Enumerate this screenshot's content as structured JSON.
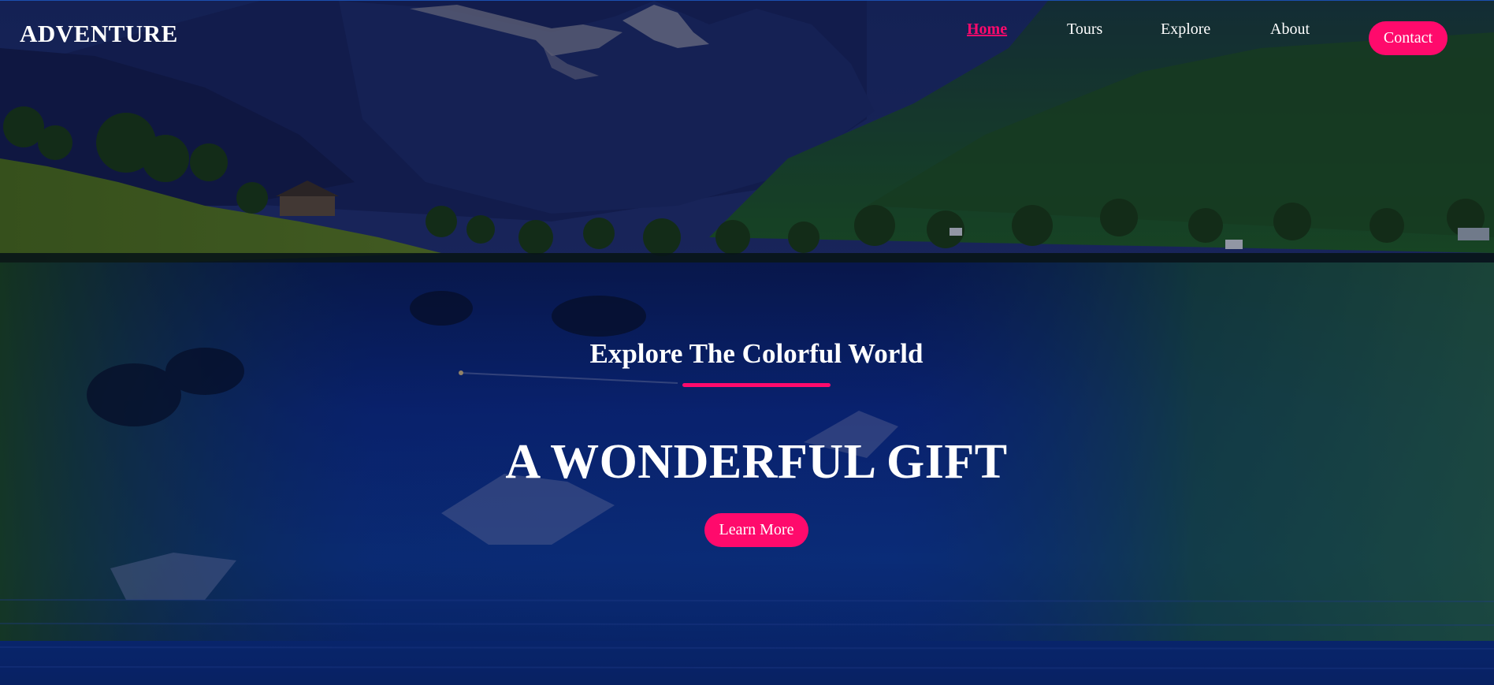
{
  "brand": {
    "name": "ADVENTURE"
  },
  "nav": {
    "items": [
      {
        "label": "Home",
        "active": true
      },
      {
        "label": "Tours",
        "active": false
      },
      {
        "label": "Explore",
        "active": false
      },
      {
        "label": "About",
        "active": false
      }
    ],
    "contact_label": "Contact"
  },
  "hero": {
    "subtitle": "Explore The Colorful World",
    "headline": "A WONDERFUL GIFT",
    "cta_label": "Learn More",
    "background_icon": "mountain-lake-landscape"
  },
  "colors": {
    "accent": "#ff0a6c",
    "text": "#ffffff",
    "sky": "#1b2a6b",
    "water": "#0d2a8a",
    "foliage": "#2e6b1c"
  }
}
